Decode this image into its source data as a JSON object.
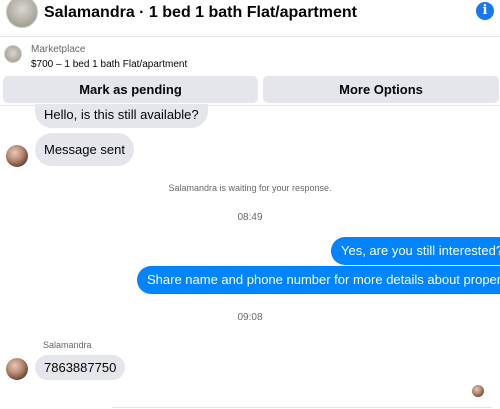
{
  "header": {
    "title": "Salamandra · 1 bed 1 bath Flat/apartment",
    "info_glyph": "i"
  },
  "listing": {
    "label": "Marketplace",
    "price_title": "$700 – 1 bed 1 bath Flat/apartment"
  },
  "actions": {
    "mark_pending": "Mark as pending",
    "more_options": "More Options"
  },
  "messages": [
    {
      "direction": "incoming",
      "text": "Hello, is this still available?"
    },
    {
      "direction": "incoming",
      "text": "Message sent"
    },
    {
      "direction": "outgoing",
      "text": "Yes, are you still interested?"
    },
    {
      "direction": "outgoing",
      "text": "Share name and phone number for more details about property."
    },
    {
      "direction": "incoming",
      "text": "7863887750"
    }
  ],
  "system": {
    "waiting": "Salamandra is waiting for your response.",
    "time1": "08:49",
    "time2": "09:08"
  },
  "sender_name": "Salamandra",
  "colors": {
    "accent": "#0084ff",
    "info": "#1877f2",
    "bubble_in": "#e4e6eb",
    "button": "#e4e6eb"
  }
}
